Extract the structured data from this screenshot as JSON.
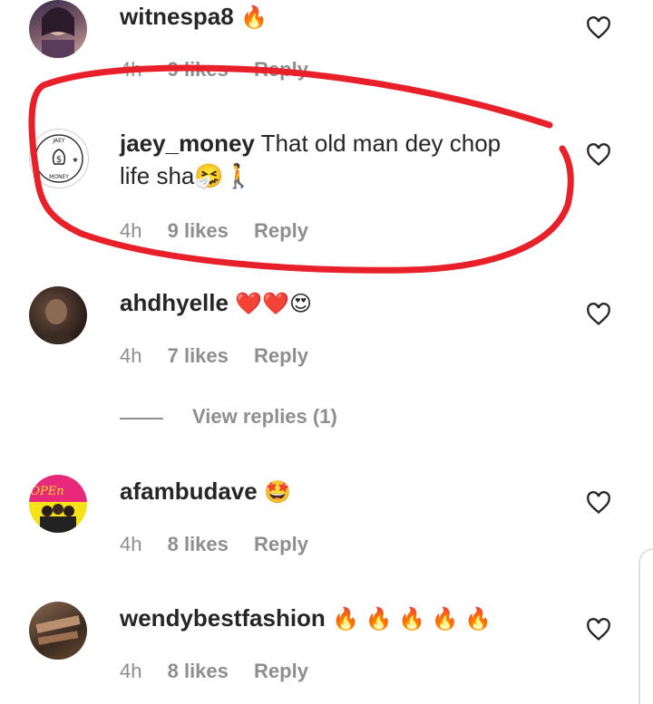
{
  "comments": [
    {
      "username": "witnespa8",
      "text": "🔥",
      "time": "4h",
      "likes": "9 likes",
      "reply": "Reply"
    },
    {
      "username": "jaey_money",
      "text": "That old man dey chop",
      "text_line2": "life sha🤧🚶",
      "time": "4h",
      "likes": "9 likes",
      "reply": "Reply",
      "avatar_text": "JAEY MONEY"
    },
    {
      "username": "ahdhyelle",
      "text": "❤️❤️😍",
      "time": "4h",
      "likes": "7 likes",
      "reply": "Reply"
    },
    {
      "username": "afambudave",
      "text": "🤩",
      "time": "4h",
      "likes": "8 likes",
      "reply": "Reply",
      "avatar_text": "OPEn"
    },
    {
      "username": "wendybestfashion",
      "text": "🔥 🔥 🔥 🔥 🔥",
      "time": "4h",
      "likes": "8 likes",
      "reply": "Reply"
    }
  ],
  "view_replies": "View replies (1)",
  "colors": {
    "text": "#262626",
    "meta": "#8e8e8e",
    "highlight": "#e8202a"
  },
  "icons": {
    "like": "heart-outline-icon"
  }
}
